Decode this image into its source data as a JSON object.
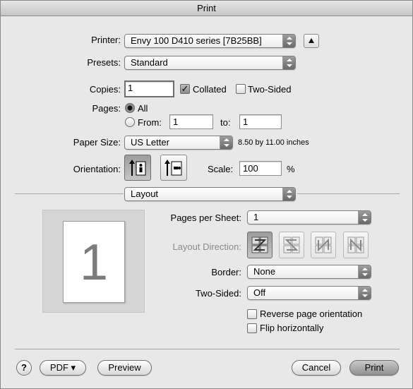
{
  "window": {
    "title": "Print"
  },
  "printer": {
    "label": "Printer:",
    "value": "Envy 100 D410 series [7B25BB]",
    "expand_icon": "triangle-up-icon"
  },
  "presets": {
    "label": "Presets:",
    "value": "Standard"
  },
  "copies": {
    "label": "Copies:",
    "value": "1",
    "collated": {
      "label": "Collated",
      "checked": true
    },
    "two_sided": {
      "label": "Two-Sided",
      "checked": false
    }
  },
  "pages": {
    "label": "Pages:",
    "all_label": "All",
    "all_selected": true,
    "from_label": "From:",
    "from_value": "1",
    "to_label": "to:",
    "to_value": "1"
  },
  "paper_size": {
    "label": "Paper Size:",
    "value": "US Letter",
    "dimensions": "8.50 by 11.00 inches"
  },
  "orientation": {
    "label": "Orientation:",
    "options": [
      "portrait-orientation-icon",
      "landscape-orientation-icon"
    ],
    "selected": "portrait"
  },
  "scale": {
    "label": "Scale:",
    "value": "100",
    "unit": "%"
  },
  "section": {
    "value": "Layout"
  },
  "preview": {
    "page_number": "1"
  },
  "layout": {
    "pages_per_sheet_label": "Pages per Sheet:",
    "pages_per_sheet_value": "1",
    "layout_direction_label": "Layout Direction:",
    "layout_direction_icons": [
      "z-direction-icon",
      "reverse-z-direction-icon",
      "n-direction-icon",
      "reverse-n-direction-icon"
    ],
    "border_label": "Border:",
    "border_value": "None",
    "two_sided_label": "Two-Sided:",
    "two_sided_value": "Off",
    "reverse_orientation_label": "Reverse page orientation",
    "flip_horizontally_label": "Flip horizontally"
  },
  "footer": {
    "help": "?",
    "pdf_label": "PDF ▾",
    "preview_label": "Preview",
    "cancel_label": "Cancel",
    "print_label": "Print"
  }
}
